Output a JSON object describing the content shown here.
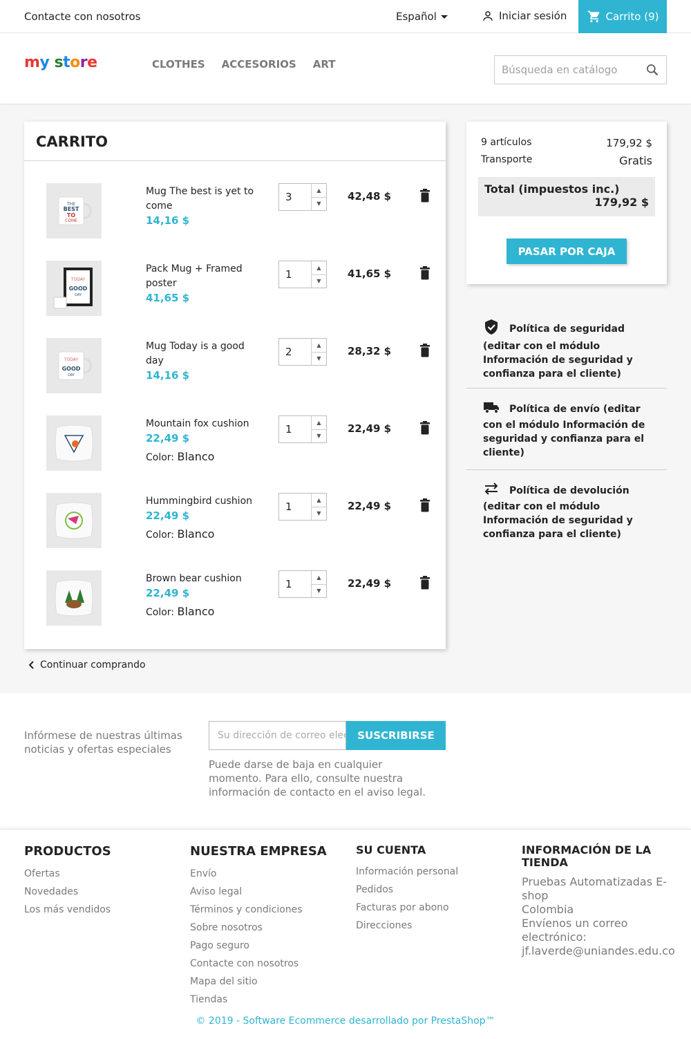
{
  "topnav": {
    "contact": "Contacte con nosotros",
    "language": "Español",
    "login": "Iniciar sesión",
    "cart": "Carrito (9)"
  },
  "header": {
    "logo_parts": [
      "m",
      "y",
      " ",
      "s",
      "t",
      "o",
      "r",
      "e"
    ],
    "menu": [
      "CLOTHES",
      "ACCESORIOS",
      "ART"
    ],
    "search_placeholder": "Búsqueda en catálogo"
  },
  "cart": {
    "title": "CARRITO",
    "lines": [
      {
        "name": "Mug The best is yet to come",
        "price": "14,16 $",
        "qty": "3",
        "total": "42,48 $",
        "thumb": "mug-best-icon"
      },
      {
        "name": "Pack Mug + Framed poster",
        "price": "41,65 $",
        "qty": "1",
        "total": "41,65 $",
        "thumb": "framed-poster-icon"
      },
      {
        "name": "Mug Today is a good day",
        "price": "14,16 $",
        "qty": "2",
        "total": "28,32 $",
        "thumb": "mug-today-icon"
      },
      {
        "name": "Mountain fox cushion",
        "price": "22,49 $",
        "attr_label": "Color:",
        "attr_value": "Blanco",
        "qty": "1",
        "total": "22,49 $",
        "thumb": "fox-cushion-icon"
      },
      {
        "name": "Hummingbird cushion",
        "price": "22,49 $",
        "attr_label": "Color:",
        "attr_value": "Blanco",
        "qty": "1",
        "total": "22,49 $",
        "thumb": "hummingbird-cushion-icon"
      },
      {
        "name": "Brown bear cushion",
        "price": "22,49 $",
        "attr_label": "Color:",
        "attr_value": "Blanco",
        "qty": "1",
        "total": "22,49 $",
        "thumb": "bear-cushion-icon"
      }
    ],
    "continue": "Continuar comprando"
  },
  "summary": {
    "items_label": "9 artículos",
    "items_value": "179,92 $",
    "shipping_label": "Transporte",
    "shipping_value": "Gratis",
    "total_label": "Total (impuestos inc.)",
    "total_value": "179,92 $",
    "checkout": "PASAR POR CAJA"
  },
  "reassurance": [
    {
      "icon": "shield-check-icon",
      "text": "Política de seguridad (editar con el módulo Información de seguridad y confianza para el cliente)"
    },
    {
      "icon": "truck-icon",
      "text": "Política de envío (editar con el módulo Información de seguridad y confianza para el cliente)"
    },
    {
      "icon": "swap-arrows-icon",
      "text": "Política de devolución (editar con el módulo Información de seguridad y confianza para el cliente)"
    }
  ],
  "newsletter": {
    "text": "Infórmese de nuestras últimas noticias y ofertas especiales",
    "placeholder": "Su dirección de correo electrónico",
    "button": "SUSCRIBIRSE",
    "note": "Puede darse de baja en cualquier momento. Para ello, consulte nuestra información de contacto en el aviso legal."
  },
  "footer": {
    "products": {
      "title": "PRODUCTOS",
      "links": [
        "Ofertas",
        "Novedades",
        "Los más vendidos"
      ]
    },
    "company": {
      "title": "NUESTRA EMPRESA",
      "links": [
        "Envío",
        "Aviso legal",
        "Términos y condiciones",
        "Sobre nosotros",
        "Pago seguro",
        "Contacte con nosotros",
        "Mapa del sitio",
        "Tiendas"
      ]
    },
    "account": {
      "title": "SU CUENTA",
      "links": [
        "Información personal",
        "Pedidos",
        "Facturas por abono",
        "Direcciones"
      ]
    },
    "store": {
      "title": "INFORMACIÓN DE LA TIENDA",
      "lines": [
        "Pruebas Automatizadas E-shop",
        "Colombia",
        "Envíenos un correo electrónico:",
        "jf.laverde@uniandes.edu.co"
      ]
    },
    "copyright": "© 2019 - Software Ecommerce desarrollado por PrestaShop™"
  },
  "colors": {
    "accent": "#2fb5d2",
    "text": "#232323",
    "muted": "#7a7a7a",
    "background": "#f6f6f6"
  }
}
